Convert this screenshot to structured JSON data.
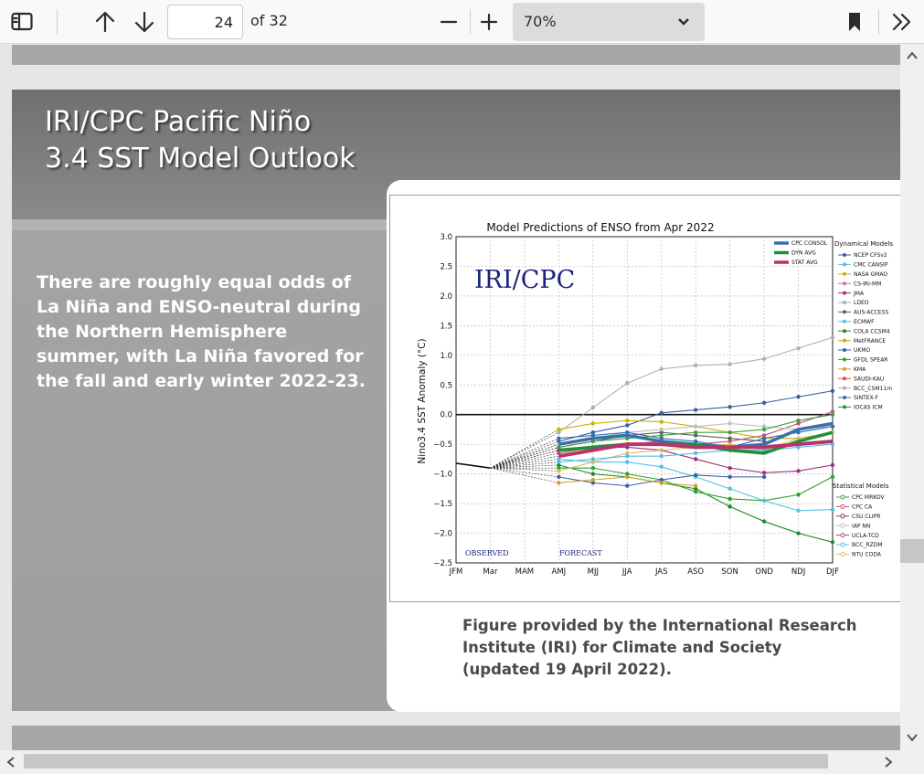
{
  "toolbar": {
    "page_number": "24",
    "page_total": "of 32",
    "zoom_value": "70%",
    "icons": [
      "sidebar-toggle-icon",
      "arrow-up-icon",
      "arrow-down-icon",
      "minus-icon",
      "plus-icon",
      "chevron-down-icon",
      "bookmark-icon",
      "double-chevron-right-icon"
    ]
  },
  "slide": {
    "title_line1": "IRI/CPC Pacific Niño",
    "title_line2": "3.4 SST Model Outlook",
    "body": "There are roughly equal odds of La Niña and ENSO-neutral during the Northern Hemisphere summer, with La Niña favored for the fall and early winter 2022-23.",
    "caption_line1": "Figure provided by the International Research",
    "caption_line2": "Institute (IRI) for Climate and Society",
    "caption_line3": "(updated 19 April 2022)."
  },
  "chart_data": {
    "type": "line",
    "title": "Model Predictions of ENSO from Apr 2022",
    "watermark": "IRI/CPC",
    "ylabel": "Nino3.4 SST Anomaly (°C)",
    "xlabel": "",
    "x": [
      "JFM",
      "Mar",
      "MAM",
      "AMJ",
      "MJJ",
      "JJA",
      "JAS",
      "ASO",
      "SON",
      "OND",
      "NDJ",
      "DJF"
    ],
    "yticks": [
      "3.0",
      "2.5",
      "2.0",
      "1.5",
      "1.0",
      "0.5",
      "0.0",
      "−0.5",
      "−1.0",
      "−1.5",
      "−2.0",
      "−2.5"
    ],
    "ylim": [
      -2.5,
      3.0
    ],
    "observed_label": "OBSERVED",
    "forecast_label": "FORECAST",
    "observed": [
      -0.82,
      -0.9
    ],
    "legend_group1": [
      "CPC CONSOL",
      "DYN AVG",
      "STAT AVG"
    ],
    "legend_dyn_title": "Dynamical Models",
    "legend_dyn": [
      "NCEP CFSv2",
      "CMC CANSIP",
      "NASA GMAO",
      "CS-IRI-MM",
      "JMA",
      "LDEO",
      "AUS-ACCESS",
      "ECMWF",
      "COLA CCSM4",
      "MetFRANCE",
      "UKMO",
      "GFDL SPEAR",
      "KMA",
      "SAUDI-KAU",
      "BCC_CSM11m",
      "SINTEX-F",
      "IOCAS ICM"
    ],
    "legend_stat_title": "Statistical Models",
    "legend_stat": [
      "CPC MRKOV",
      "CPC CA",
      "CSU CLIPR",
      "IAP NN",
      "UCLA-TCD",
      "BCC_RZDM",
      "NTU CODA"
    ],
    "series": [
      {
        "name": "CPC CONSOL",
        "color": "#3a6fa8",
        "width": 3.5,
        "values": [
          null,
          null,
          null,
          -0.5,
          -0.4,
          -0.35,
          -0.45,
          -0.5,
          -0.55,
          -0.5,
          -0.25,
          -0.15
        ]
      },
      {
        "name": "DYN AVG",
        "color": "#1f8f3a",
        "width": 3.5,
        "values": [
          null,
          null,
          null,
          -0.6,
          -0.55,
          -0.5,
          -0.5,
          -0.5,
          -0.6,
          -0.65,
          -0.45,
          -0.3
        ]
      },
      {
        "name": "STAT AVG",
        "color": "#b8336a",
        "width": 4,
        "values": [
          null,
          null,
          null,
          -0.7,
          -0.6,
          -0.5,
          -0.5,
          -0.55,
          -0.55,
          -0.55,
          -0.5,
          -0.45
        ]
      },
      {
        "name": "LDEO",
        "color": "#b0b0b0",
        "values": [
          null,
          null,
          null,
          -0.3,
          0.12,
          0.53,
          0.77,
          0.83,
          0.85,
          0.94,
          1.12,
          1.3
        ]
      },
      {
        "name": "NCEP CFSv2",
        "color": "#3a5fa0",
        "values": [
          null,
          null,
          null,
          -0.45,
          -0.3,
          -0.18,
          0.03,
          0.08,
          0.13,
          0.2,
          0.3,
          0.4
        ]
      },
      {
        "name": "COLA CCSM4",
        "color": "#1e8a2a",
        "values": [
          null,
          null,
          null,
          -0.85,
          -1.0,
          -1.05,
          -1.15,
          -1.25,
          -1.55,
          -1.8,
          -2.0,
          -2.15
        ]
      },
      {
        "name": "GFDL SPEAR",
        "color": "#2ca02c",
        "values": [
          null,
          null,
          null,
          -0.9,
          -0.9,
          -1.0,
          -1.1,
          -1.3,
          -1.42,
          -1.45,
          -1.35,
          -1.05
        ]
      },
      {
        "name": "ECMWF",
        "color": "#4fc3e0",
        "values": [
          null,
          null,
          null,
          -0.75,
          -0.8,
          -0.8,
          -0.88,
          -1.05,
          -1.25,
          -1.45,
          -1.62,
          -1.6
        ]
      },
      {
        "name": "UKMO",
        "color": "#3a5fa8",
        "values": [
          null,
          null,
          null,
          -1.05,
          -1.15,
          -1.2,
          -1.1,
          -1.02,
          -1.05,
          -1.05,
          null,
          null
        ]
      },
      {
        "name": "JMA",
        "color": "#a0307a",
        "values": [
          null,
          null,
          null,
          -0.6,
          -0.55,
          -0.55,
          -0.6,
          -0.75,
          -0.9,
          -0.98,
          -0.95,
          -0.85
        ]
      },
      {
        "name": "NASA GMAO",
        "color": "#c8b400",
        "values": [
          null,
          null,
          null,
          -0.25,
          -0.15,
          -0.1,
          -0.12,
          -0.2,
          -0.3,
          -0.4,
          -0.4,
          -0.3
        ]
      },
      {
        "name": "MetFRANCE",
        "color": "#d4a020",
        "values": [
          null,
          null,
          null,
          -1.15,
          -1.1,
          -1.05,
          -1.15,
          -1.2,
          null,
          null,
          null,
          null
        ]
      },
      {
        "name": "AUS-ACCESS",
        "color": "#606060",
        "values": [
          null,
          null,
          null,
          -0.55,
          -0.45,
          -0.35,
          -0.3,
          -0.35,
          -0.4,
          -0.45,
          null,
          null
        ]
      },
      {
        "name": "CPC CA",
        "color": "#c8506a",
        "values": [
          null,
          null,
          null,
          -0.65,
          -0.55,
          -0.5,
          -0.45,
          -0.5,
          -0.45,
          -0.35,
          -0.15,
          0.05
        ]
      },
      {
        "name": "IAP NN",
        "color": "#c0c0c0",
        "values": [
          null,
          null,
          null,
          -0.5,
          -0.4,
          -0.3,
          -0.25,
          -0.2,
          -0.15,
          -0.2,
          -0.25,
          -0.2
        ]
      },
      {
        "name": "NTU CODA",
        "color": "#d8c060",
        "values": [
          null,
          null,
          null,
          -0.95,
          -0.8,
          -0.65,
          -0.6,
          -0.55,
          -0.5,
          -0.6,
          -0.4,
          -0.3
        ]
      },
      {
        "name": "SINTEX-F",
        "color": "#3070c0",
        "values": [
          null,
          null,
          null,
          -0.4,
          -0.35,
          -0.3,
          -0.4,
          -0.45,
          -0.55,
          -0.4,
          -0.3,
          -0.2
        ]
      },
      {
        "name": "CPC MRKOV",
        "color": "#40a040",
        "values": [
          null,
          null,
          null,
          -0.55,
          -0.45,
          -0.4,
          -0.35,
          -0.3,
          -0.3,
          -0.25,
          -0.1,
          0.0
        ]
      },
      {
        "name": "CMC CANSIP",
        "color": "#5cb8e6",
        "values": [
          null,
          null,
          null,
          -0.8,
          -0.75,
          -0.7,
          -0.7,
          -0.65,
          -0.6,
          -0.6,
          -0.55,
          -0.5
        ]
      }
    ]
  }
}
